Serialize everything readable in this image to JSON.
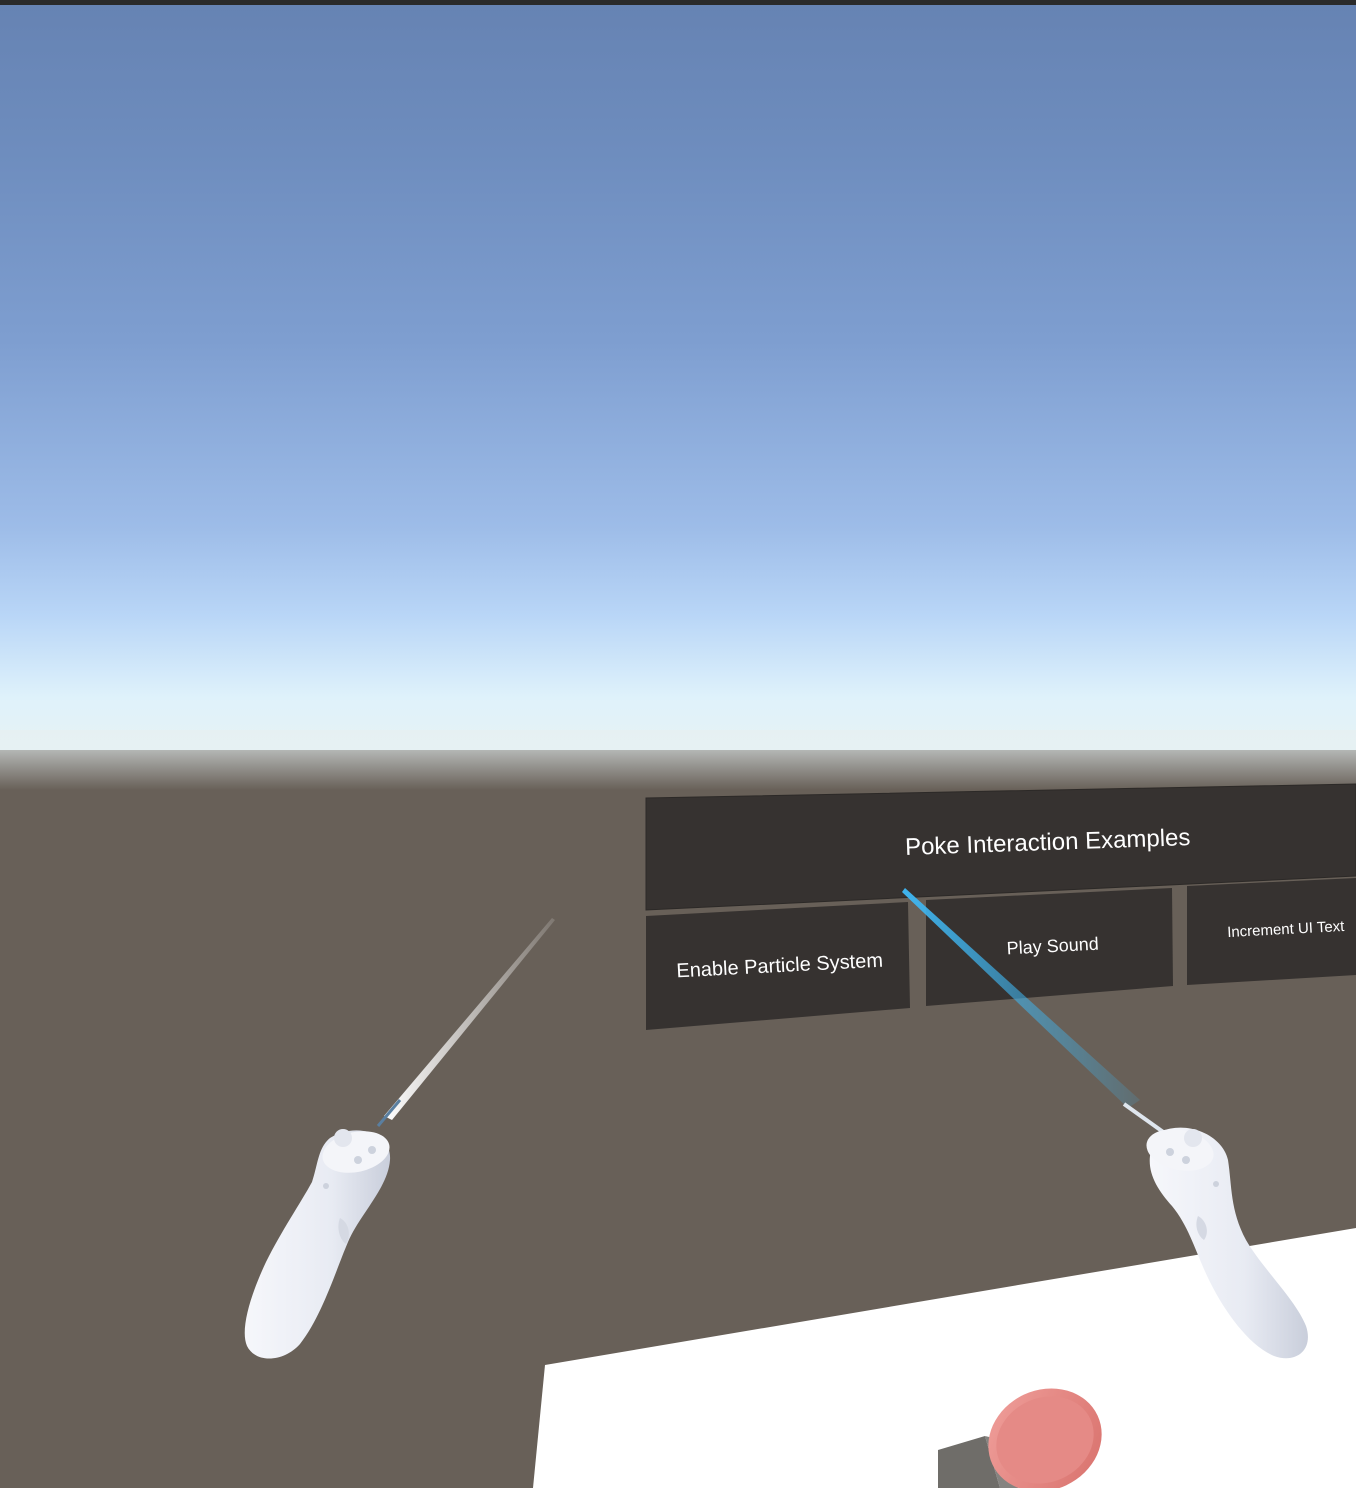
{
  "scene": {
    "sky_top_color": "#6683b3",
    "horizon_color": "#e6f3f4",
    "ground_color": "#686058",
    "table_color": "#ffffff",
    "panel_color": "#363230",
    "ray_left_color": "#ffffff",
    "ray_right_color": "#3fb4ee",
    "controller_color": "#eef0f8",
    "poke_button_color": "#e58a86"
  },
  "panel": {
    "title": "Poke Interaction Examples",
    "buttons": [
      {
        "label": "Enable Particle System"
      },
      {
        "label": "Play Sound"
      },
      {
        "label": "Increment UI Text"
      }
    ]
  }
}
